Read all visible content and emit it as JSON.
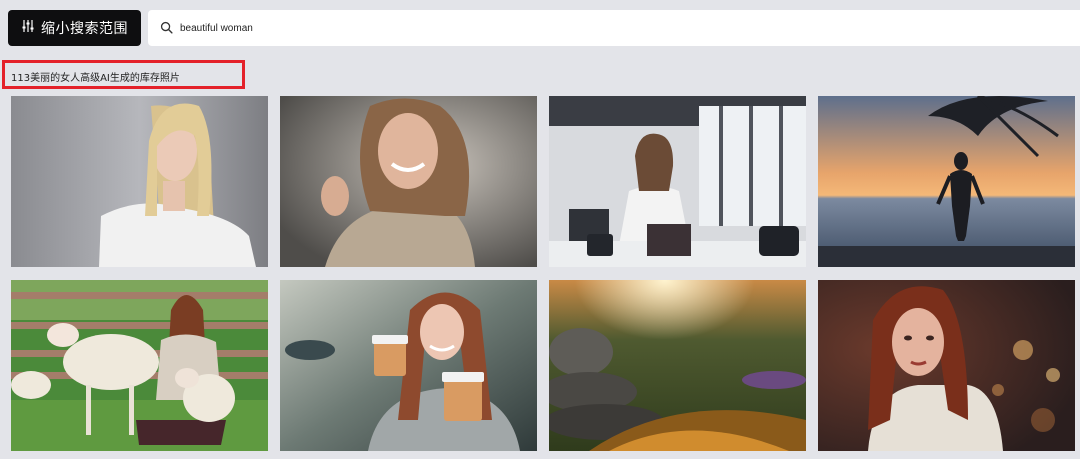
{
  "filter_button": {
    "label": "缩小搜索范围",
    "icon": "sliders-icon"
  },
  "search": {
    "value": "beautiful woman",
    "icon": "search-icon"
  },
  "results": {
    "count_text": "113美丽的女人高级AI生成的库存照片",
    "highlight_color": "#e4212a"
  },
  "images": [
    {
      "subject": "blonde-woman-white-tshirt"
    },
    {
      "subject": "smiling-woman-sweater"
    },
    {
      "subject": "woman-office-desk"
    },
    {
      "subject": "silhouette-beach-sunset"
    },
    {
      "subject": "woman-with-sheep"
    },
    {
      "subject": "woman-holding-coffee-cups"
    },
    {
      "subject": "stones-sunset-field"
    },
    {
      "subject": "redhead-woman-bokeh"
    }
  ],
  "colors": {
    "background": "#e3e4e9",
    "button_bg": "#0e0e10",
    "search_bg": "#ffffff"
  }
}
